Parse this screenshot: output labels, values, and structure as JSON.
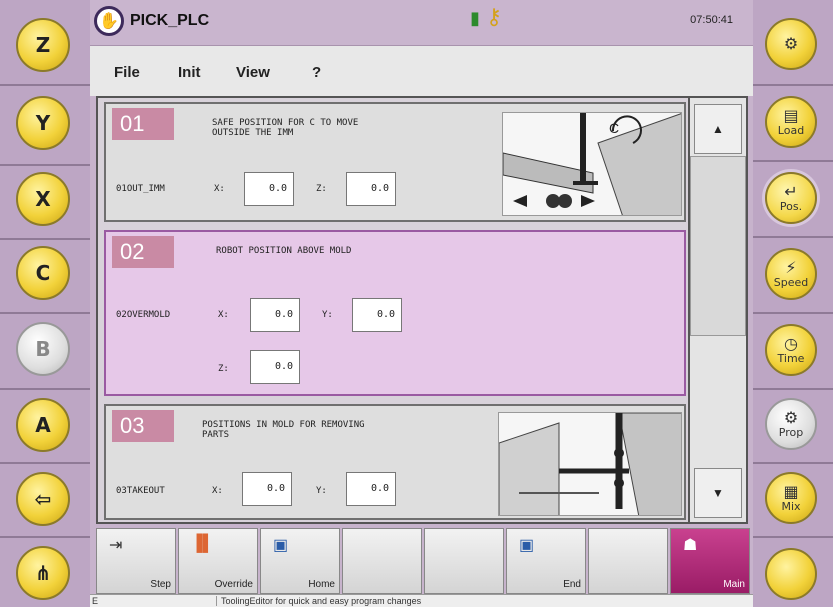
{
  "app": {
    "title": "PICK_PLC",
    "clock": "07:50:41"
  },
  "menu": {
    "file": "File",
    "init": "Init",
    "view": "View",
    "help": "?"
  },
  "left_rail": {
    "z": "Z",
    "y": "Y",
    "x": "X",
    "c": "C",
    "b": "B",
    "a": "A"
  },
  "right_rail": {
    "load": "Load",
    "pos": "Pos.",
    "speed": "Speed",
    "time": "Time",
    "prop": "Prop",
    "mix": "Mix"
  },
  "cards": [
    {
      "num": "01",
      "desc": "SAFE POSITION FOR C TO MOVE\nOUTSIDE THE IMM",
      "name": "01OUT_IMM",
      "f1_label": "X:",
      "f1_value": "0.0",
      "f2_label": "Z:",
      "f2_value": "0.0"
    },
    {
      "num": "02",
      "desc": "ROBOT POSITION ABOVE MOLD",
      "name": "02OVERMOLD",
      "f1_label": "X:",
      "f1_value": "0.0",
      "f2_label": "Y:",
      "f2_value": "0.0",
      "f3_label": "Z:",
      "f3_value": "0.0"
    },
    {
      "num": "03",
      "desc": "POSITIONS IN MOLD FOR REMOVING\nPARTS",
      "name": "03TAKEOUT",
      "f1_label": "X:",
      "f1_value": "0.0",
      "f2_label": "Y:",
      "f2_value": "0.0"
    }
  ],
  "toolbar": {
    "step": "Step",
    "override": "Override",
    "home": "Home",
    "end": "End",
    "main": "Main"
  },
  "status": {
    "left": "E",
    "message": "ToolingEditor for quick and easy program changes"
  }
}
